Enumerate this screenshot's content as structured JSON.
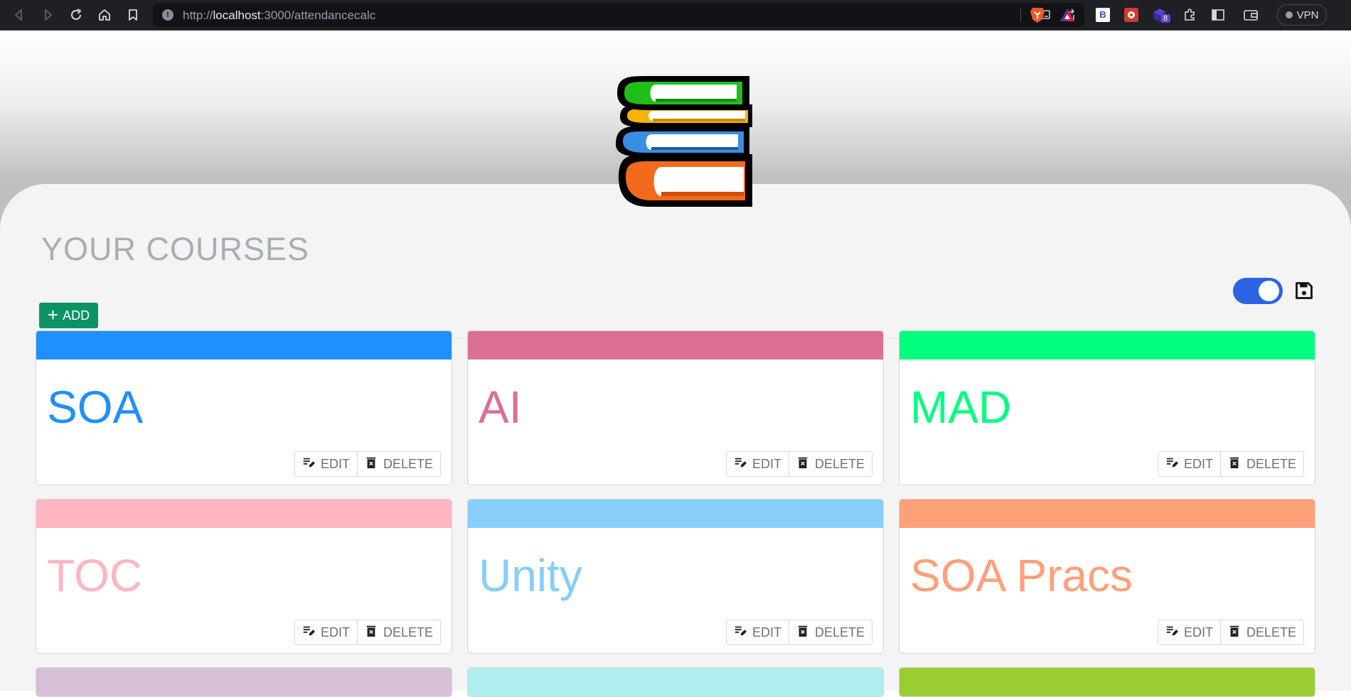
{
  "browser": {
    "url_prefix": "http://",
    "url_host": "localhost",
    "url_rest": ":3000/attendancecalc",
    "vpn_label": "VPN",
    "ext_badge": "8",
    "ext_letter": "B"
  },
  "page": {
    "heading": "YOUR COURSES",
    "add_label": "ADD",
    "toggle_on": true
  },
  "courses": [
    {
      "name": "SOA",
      "color": "#1e90ff",
      "edit": "EDIT",
      "delete": "DELETE"
    },
    {
      "name": "AI",
      "color": "#db7093",
      "edit": "EDIT",
      "delete": "DELETE"
    },
    {
      "name": "MAD",
      "color": "#00ff7f",
      "edit": "EDIT",
      "delete": "DELETE"
    },
    {
      "name": "TOC",
      "color": "#ffb6c1",
      "edit": "EDIT",
      "delete": "DELETE"
    },
    {
      "name": "Unity",
      "color": "#87cefa",
      "edit": "EDIT",
      "delete": "DELETE"
    },
    {
      "name": "SOA Pracs",
      "color": "#ffa07a",
      "edit": "EDIT",
      "delete": "DELETE"
    },
    {
      "name": "",
      "color": "#d8bfd8"
    },
    {
      "name": "",
      "color": "#afeeee"
    },
    {
      "name": "",
      "color": "#9acd32"
    }
  ],
  "icons": [
    "back-icon",
    "forward-icon",
    "reload-icon",
    "home-icon",
    "bookmark-icon",
    "info-icon",
    "cast-icon",
    "share-icon",
    "brave-icon",
    "rewards-icon",
    "extensions-icon",
    "sidebar-icon",
    "wallet-icon",
    "books-logo",
    "save-icon",
    "edit-icon",
    "delete-icon",
    "plus-icon"
  ]
}
